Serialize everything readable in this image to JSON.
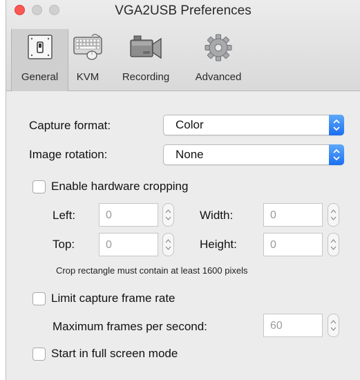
{
  "window": {
    "title": "VGA2USB Preferences"
  },
  "toolbar": {
    "tabs": [
      {
        "label": "General",
        "icon": "switch-icon",
        "selected": true
      },
      {
        "label": "KVM",
        "icon": "keyboard-mouse-icon",
        "selected": false
      },
      {
        "label": "Recording",
        "icon": "video-camera-icon",
        "selected": false
      },
      {
        "label": "Advanced",
        "icon": "gear-icon",
        "selected": false
      }
    ]
  },
  "general": {
    "capture_format_label": "Capture format:",
    "capture_format_value": "Color",
    "image_rotation_label": "Image rotation:",
    "image_rotation_value": "None",
    "enable_cropping_label": "Enable hardware cropping",
    "enable_cropping_checked": false,
    "left_label": "Left:",
    "left_value": "0",
    "top_label": "Top:",
    "top_value": "0",
    "width_label": "Width:",
    "width_value": "0",
    "height_label": "Height:",
    "height_value": "0",
    "crop_note": "Crop rectangle must contain at least 1600 pixels",
    "limit_frame_rate_label": "Limit capture frame rate",
    "limit_frame_rate_checked": false,
    "max_fps_label": "Maximum frames per second:",
    "max_fps_value": "60",
    "fullscreen_label": "Start in full screen mode",
    "fullscreen_checked": false
  },
  "colors": {
    "accent": "#1b6ff2",
    "close_button": "#fc5753",
    "selected_tab": "#cfcfcf",
    "window_bg": "#ececec"
  }
}
